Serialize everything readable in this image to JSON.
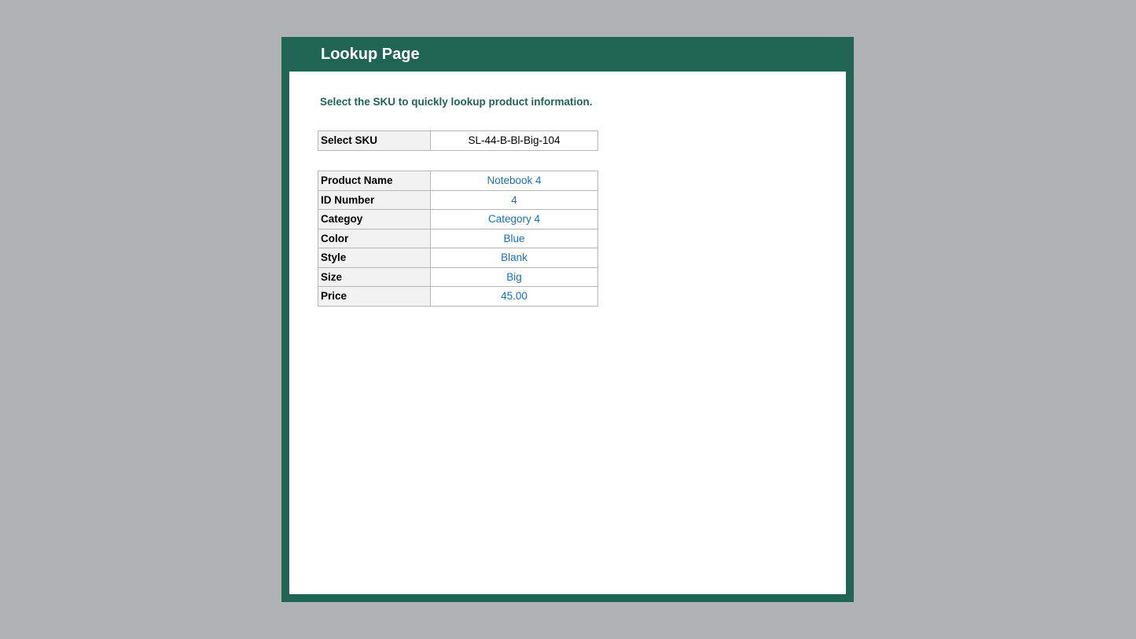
{
  "page": {
    "title": "Lookup Page",
    "instructions": "Select the SKU to quickly lookup product information."
  },
  "sku": {
    "label": "Select SKU",
    "value": "SL-44-B-Bl-Big-104"
  },
  "product_info": {
    "rows": [
      {
        "label": "Product Name",
        "value": "Notebook 4"
      },
      {
        "label": "ID Number",
        "value": "4"
      },
      {
        "label": "Categoy",
        "value": "Category 4"
      },
      {
        "label": "Color",
        "value": "Blue"
      },
      {
        "label": "Style",
        "value": "Blank"
      },
      {
        "label": "Size",
        "value": "Big"
      },
      {
        "label": "Price",
        "value": "45.00"
      }
    ]
  },
  "colors": {
    "background": "#b1b2b3",
    "frame": "#206453",
    "label_fill": "#f2f2f2",
    "value_text": "#1a6ec0"
  }
}
